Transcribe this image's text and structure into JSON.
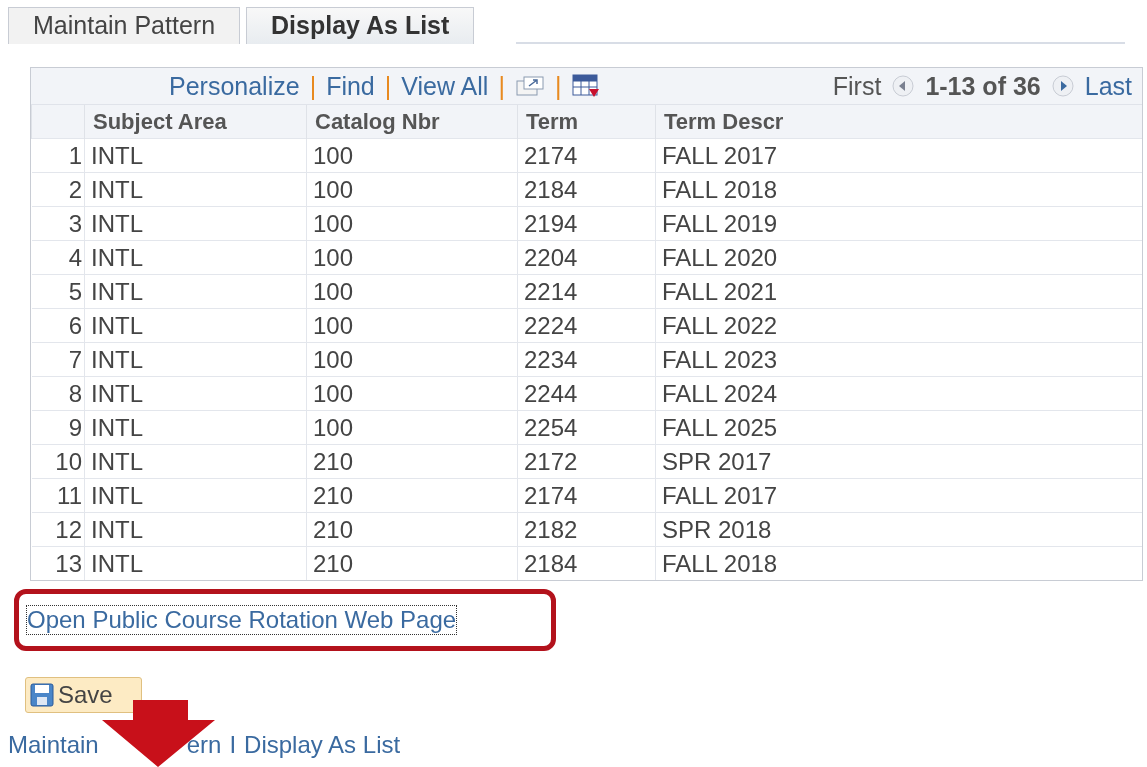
{
  "tabs": [
    {
      "label": "Maintain Pattern",
      "selected": false
    },
    {
      "label": "Display As List",
      "selected": true
    }
  ],
  "grid": {
    "toolbar": {
      "personalize": "Personalize",
      "find": "Find",
      "view_all": "View All",
      "separator": "|",
      "first": "First",
      "range": "1-13 of 36",
      "last": "Last"
    },
    "columns": [
      "Subject Area",
      "Catalog Nbr",
      "Term",
      "Term Descr"
    ],
    "rows": [
      {
        "num": "1",
        "cells": [
          "INTL",
          "100",
          "2174",
          "FALL 2017"
        ]
      },
      {
        "num": "2",
        "cells": [
          "INTL",
          "100",
          "2184",
          "FALL 2018"
        ]
      },
      {
        "num": "3",
        "cells": [
          "INTL",
          "100",
          "2194",
          "FALL 2019"
        ]
      },
      {
        "num": "4",
        "cells": [
          "INTL",
          "100",
          "2204",
          "FALL 2020"
        ]
      },
      {
        "num": "5",
        "cells": [
          "INTL",
          "100",
          "2214",
          "FALL 2021"
        ]
      },
      {
        "num": "6",
        "cells": [
          "INTL",
          "100",
          "2224",
          "FALL 2022"
        ]
      },
      {
        "num": "7",
        "cells": [
          "INTL",
          "100",
          "2234",
          "FALL 2023"
        ]
      },
      {
        "num": "8",
        "cells": [
          "INTL",
          "100",
          "2244",
          "FALL 2024"
        ]
      },
      {
        "num": "9",
        "cells": [
          "INTL",
          "100",
          "2254",
          "FALL 2025"
        ]
      },
      {
        "num": "10",
        "cells": [
          "INTL",
          "210",
          "2172",
          "SPR 2017"
        ]
      },
      {
        "num": "11",
        "cells": [
          "INTL",
          "210",
          "2174",
          "FALL 2017"
        ]
      },
      {
        "num": "12",
        "cells": [
          "INTL",
          "210",
          "2182",
          "SPR 2018"
        ]
      },
      {
        "num": "13",
        "cells": [
          "INTL",
          "210",
          "2184",
          "FALL 2018"
        ]
      }
    ]
  },
  "highlighted_link": "Open Public Course Rotation Web Page",
  "save_button": "Save",
  "bottom_links": {
    "first_start": "Maintain",
    "first_end": "ern",
    "separator": "I",
    "second": "Display As List"
  }
}
